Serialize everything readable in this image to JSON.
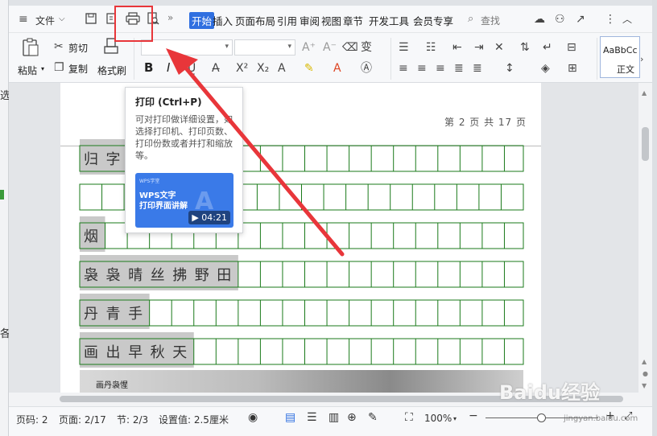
{
  "titlebar": {
    "file_menu": "文件",
    "tabs": [
      "开始",
      "插入",
      "页面布局",
      "引用",
      "审阅",
      "视图",
      "章节",
      "开发工具",
      "会员专享"
    ],
    "active_tab": "开始",
    "search": "查找",
    "more": "»"
  },
  "ribbon": {
    "paste": "粘贴",
    "cut": "剪切",
    "copy": "复制",
    "format_painter": "格式刷",
    "font_name": "",
    "font_size": "",
    "bold": "B",
    "italic": "I",
    "style_preview": "AaBbCc",
    "style_name": "正文"
  },
  "left_strip": {
    "char_top": "选",
    "char_mid": "各"
  },
  "tooltip": {
    "title": "打印 (Ctrl+P)",
    "description": "可对打印做详细设置，如选择打印机、打印页数、打印份数或者并打和缩放等。",
    "video_brand": "WPS学堂",
    "video_title": "WPS文字\n打印界面讲解",
    "video_duration": "04:21"
  },
  "document": {
    "page_number": "第 2 页 共 17 页",
    "rows": [
      {
        "text": "归字",
        "cols": 20
      },
      {
        "text": "",
        "cols": 20
      },
      {
        "text": "烟",
        "cols": 20
      },
      {
        "text": "袅袅晴丝拂野田",
        "cols": 13
      },
      {
        "text": "丹青手",
        "cols": 17
      },
      {
        "text": "画出早秋天",
        "cols": 15
      }
    ],
    "image_caption": "画丹袅惺"
  },
  "statusbar": {
    "page_code": "页码: 2",
    "page": "页面: 2/17",
    "section": "节: 2/3",
    "setting": "设置值: 2.5厘米",
    "zoom": "100%"
  },
  "watermark": {
    "brand": "Baidu经验",
    "url": "jingyan.baidu.com"
  },
  "colors": {
    "accent": "#2f6fe0",
    "grid": "#1a7a1a",
    "annotation": "#e8363a"
  }
}
